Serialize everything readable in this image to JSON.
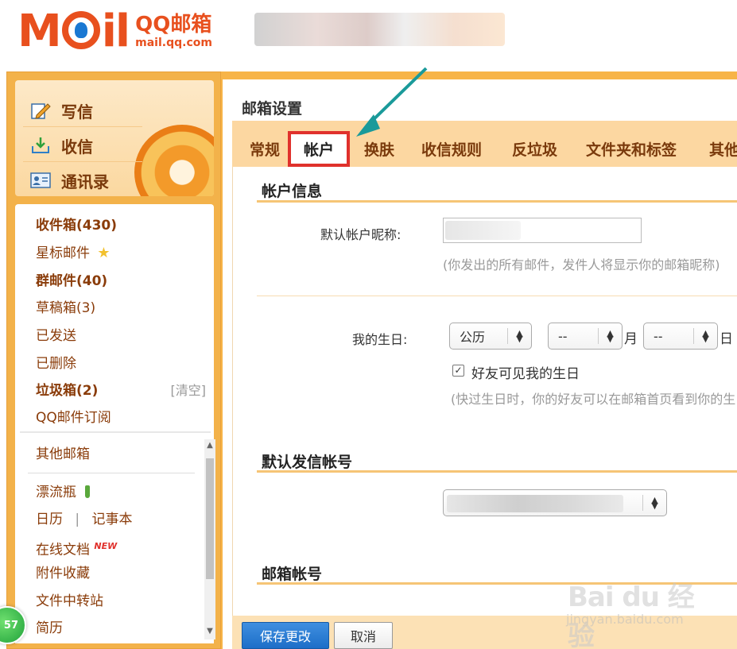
{
  "header": {
    "logo_word": "M",
    "logo_word_end": "il",
    "logo_product": "QQ邮箱",
    "logo_domain": "mail.qq.com"
  },
  "quick_actions": [
    {
      "label": "写信",
      "icon": "pencil-icon"
    },
    {
      "label": "收信",
      "icon": "inbox-download-icon"
    },
    {
      "label": "通讯录",
      "icon": "contact-card-icon"
    }
  ],
  "folders": {
    "inbox": "收件箱(430)",
    "starred": "星标邮件",
    "group": "群邮件(40)",
    "drafts": "草稿箱(3)",
    "sent": "已发送",
    "deleted": "已删除",
    "spam": "垃圾箱(2)",
    "spam_clear": "[清空]",
    "subscription": "QQ邮件订阅",
    "other_mailbox": "其他邮箱",
    "bottle": "漂流瓶",
    "calendar": "日历",
    "separator": "|",
    "notepad": "记事本",
    "online_docs": "在线文档",
    "new_badge": "NEW",
    "attachments": "附件收藏",
    "file_transfer": "文件中转站",
    "resume": "简历"
  },
  "side_badge": "57",
  "settings": {
    "title": "邮箱设置",
    "tabs": [
      "常规",
      "帐户",
      "换肤",
      "收信规则",
      "反垃圾",
      "文件夹和标签",
      "其他"
    ],
    "active_tab": "帐户"
  },
  "account_info": {
    "section_title": "帐户信息",
    "nickname_label": "默认帐户昵称:",
    "nickname_hint": "(你发出的所有邮件，发件人将显示你的邮箱昵称)",
    "birthday_label": "我的生日:",
    "calendar_type": "公历",
    "month_value": "--",
    "month_unit": "月",
    "day_value": "--",
    "day_unit": "日",
    "friends_visible_label": "好友可见我的生日",
    "friends_visible_checked": true,
    "birthday_hint": "(快过生日时，你的好友可以在邮箱首页看到你的生日)"
  },
  "default_sender": {
    "section_title": "默认发信帐号"
  },
  "mailbox_account": {
    "section_title": "邮箱帐号"
  },
  "actions": {
    "save": "保存更改",
    "cancel": "取消"
  },
  "watermark": {
    "brand": "Bai du 经验",
    "url": "jingyan.baidu.com"
  },
  "colors": {
    "brand_orange": "#e8501e",
    "panel_orange": "#f7b448",
    "highlight_red": "#e0312c",
    "arrow_teal": "#1a9a9a",
    "primary_blue": "#1d6ec8"
  }
}
